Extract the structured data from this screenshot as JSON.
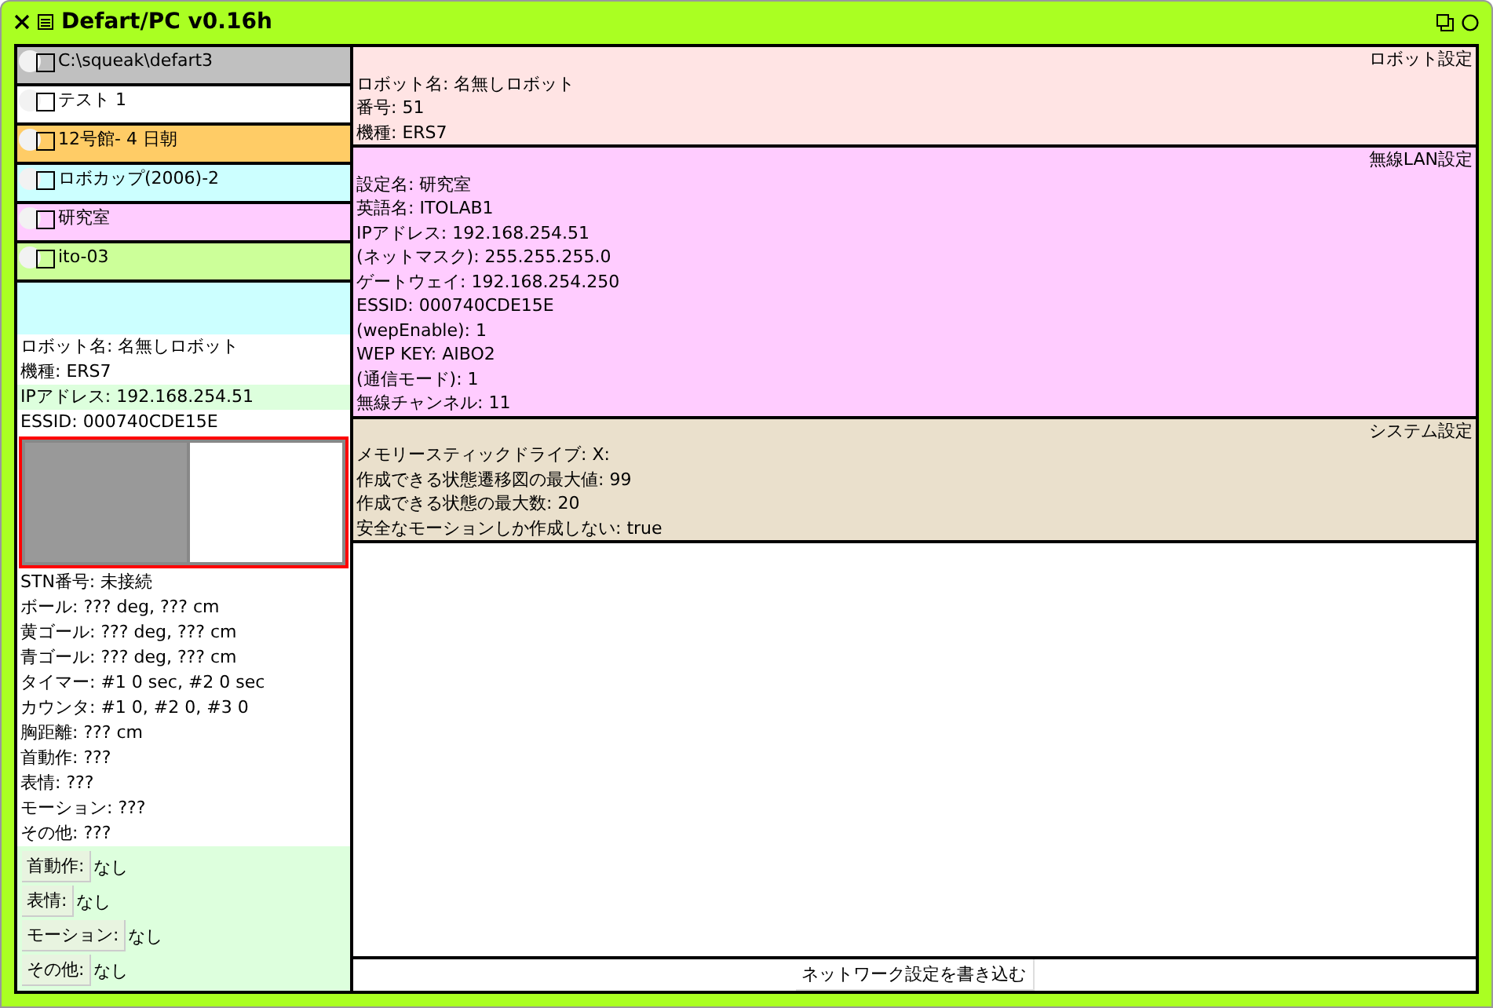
{
  "window": {
    "title": "Defart/PC v0.16h"
  },
  "profiles": [
    {
      "label": "C:\\squeak\\defart3",
      "color": "#c0c0c0",
      "checked": false
    },
    {
      "label": "テスト 1",
      "color": "#ffffff",
      "checked": false
    },
    {
      "label": "12号館- 4 日朝",
      "color": "#ffcc66",
      "checked": false
    },
    {
      "label": "ロボカップ(2006)-2",
      "color": "#ccffff",
      "checked": false
    },
    {
      "label": "研究室",
      "color": "#ffccff",
      "checked": false
    },
    {
      "label": "ito-03",
      "color": "#ccff99",
      "checked": false
    }
  ],
  "robot_summary": [
    {
      "text": "ロボット名: 名無しロボット",
      "highlight": false
    },
    {
      "text": "機種: ERS7",
      "highlight": false
    },
    {
      "text": "IPアドレス: 192.168.254.51",
      "highlight": true
    },
    {
      "text": "ESSID: 000740CDE15E",
      "highlight": false
    }
  ],
  "status_lines": [
    "STN番号: 未接続",
    "ボール: ??? deg, ??? cm",
    "黄ゴール: ??? deg, ??? cm",
    "青ゴール: ??? deg, ??? cm",
    "タイマー: #1 0 sec, #2 0 sec",
    "カウンタ: #1 0, #2 0, #3 0",
    "胸距離: ??? cm",
    "首動作: ???",
    "表情: ???",
    "モーション: ???",
    "その他: ???"
  ],
  "actions": [
    {
      "button": "首動作:",
      "value": "なし"
    },
    {
      "button": "表情:",
      "value": "なし"
    },
    {
      "button": "モーション:",
      "value": "なし"
    },
    {
      "button": "その他:",
      "value": "なし"
    }
  ],
  "sections": [
    {
      "title": "ロボット設定",
      "color": "#ffe4e4",
      "lines": [
        "ロボット名: 名無しロボット",
        "番号: 51",
        "機種: ERS7"
      ]
    },
    {
      "title": "無線LAN設定",
      "color": "#ffccff",
      "lines": [
        "設定名: 研究室",
        "英語名: ITOLAB1",
        "IPアドレス: 192.168.254.51",
        "(ネットマスク): 255.255.255.0",
        "ゲートウェイ: 192.168.254.250",
        "ESSID: 000740CDE15E",
        "(wepEnable): 1",
        "WEP KEY: AIBO2",
        "(通信モード): 1",
        "無線チャンネル: 11"
      ]
    },
    {
      "title": "システム設定",
      "color": "#eae0cc",
      "lines": [
        "メモリースティックドライブ: X:",
        "作成できる状態遷移図の最大値: 99",
        "作成できる状態の最大数: 20",
        "安全なモーションしか作成しない: true"
      ]
    }
  ],
  "write_button": "ネットワーク設定を書き込む"
}
